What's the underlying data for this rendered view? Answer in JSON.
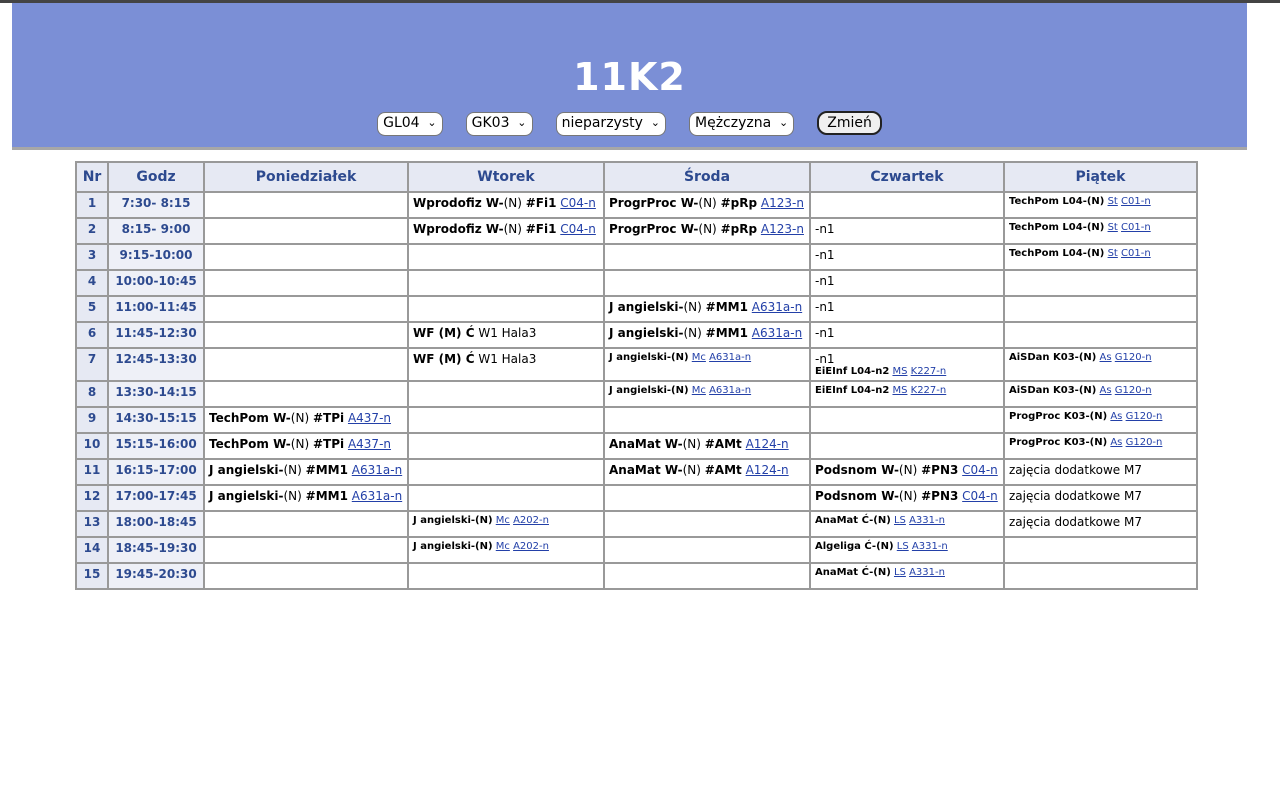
{
  "title": "11K2",
  "controls": {
    "selects": [
      "GL04",
      "GK03",
      "nieparzysty",
      "Mężczyzna"
    ],
    "button": "Zmień"
  },
  "table": {
    "headers": [
      "Nr",
      "Godz",
      "Poniedziałek",
      "Wtorek",
      "Środa",
      "Czwartek",
      "Piątek"
    ],
    "rows": [
      {
        "nr": "1",
        "godz": "7:30- 8:15"
      },
      {
        "nr": "2",
        "godz": "8:15- 9:00"
      },
      {
        "nr": "3",
        "godz": "9:15-10:00"
      },
      {
        "nr": "4",
        "godz": "10:00-10:45"
      },
      {
        "nr": "5",
        "godz": "11:00-11:45"
      },
      {
        "nr": "6",
        "godz": "11:45-12:30"
      },
      {
        "nr": "7",
        "godz": "12:45-13:30"
      },
      {
        "nr": "8",
        "godz": "13:30-14:15"
      },
      {
        "nr": "9",
        "godz": "14:30-15:15"
      },
      {
        "nr": "10",
        "godz": "15:15-16:00"
      },
      {
        "nr": "11",
        "godz": "16:15-17:00"
      },
      {
        "nr": "12",
        "godz": "17:00-17:45"
      },
      {
        "nr": "13",
        "godz": "18:00-18:45"
      },
      {
        "nr": "14",
        "godz": "18:45-19:30"
      },
      {
        "nr": "15",
        "godz": "19:45-20:30"
      }
    ]
  },
  "entries": {
    "wprodofiz": {
      "subject": "Wprodofiz W-",
      "type": "(N)",
      "group": "#Fi1",
      "room": "C04-n"
    },
    "progrproc": {
      "subject": "ProgrProc W-",
      "type": "(N)",
      "group": "#pRp",
      "room": "A123-n"
    },
    "techpom_l": {
      "subject": "TechPom L04-(N)",
      "teacher": "St",
      "room": "C01-n"
    },
    "n1": "-n1",
    "jang_mm1": {
      "subject": "J angielski-",
      "type": "(N)",
      "group": "#MM1",
      "room": "A631a-n"
    },
    "wf": {
      "subject": "WF (M) Ć",
      "place": "W1 Hala3"
    },
    "jang_mc_a631": {
      "subject": "J angielski-(N)",
      "teacher": "Mc",
      "room": "A631a-n"
    },
    "eieinf": {
      "subject": "EiEInf L04-n2",
      "teacher": "MS",
      "room": "K227-n"
    },
    "aisdan": {
      "subject": "AiSDan K03-(N)",
      "teacher": "As",
      "room": "G120-n"
    },
    "techpom_w": {
      "subject": "TechPom W-",
      "type": "(N)",
      "group": "#TPi",
      "room": "A437-n"
    },
    "progproc_k": {
      "subject": "ProgProc K03-(N)",
      "teacher": "As",
      "room": "G120-n"
    },
    "anamat_w": {
      "subject": "AnaMat W-",
      "type": "(N)",
      "group": "#AMt",
      "room": "A124-n"
    },
    "podsnom": {
      "subject": "Podsnom W-",
      "type": "(N)",
      "group": "#PN3",
      "room": "C04-n"
    },
    "zajecia": "zajęcia dodatkowe M7",
    "jang_mc_a202": {
      "subject": "J angielski-(N)",
      "teacher": "Mc",
      "room": "A202-n"
    },
    "anamat_c": {
      "subject": "AnaMat Ć-(N)",
      "teacher": "LS",
      "room": "A331-n"
    },
    "algeliga": {
      "subject": "Algeliga Ć-(N)",
      "teacher": "LS",
      "room": "A331-n"
    }
  }
}
